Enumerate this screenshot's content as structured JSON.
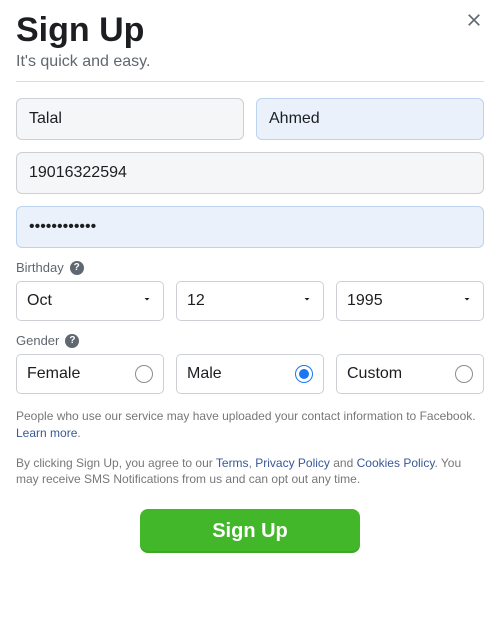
{
  "header": {
    "title": "Sign Up",
    "subtitle": "It's quick and easy."
  },
  "form": {
    "first_name": "Talal",
    "last_name": "Ahmed",
    "contact": "19016322594",
    "password": "••••••••••••"
  },
  "birthday": {
    "label": "Birthday",
    "month": "Oct",
    "day": "12",
    "year": "1995"
  },
  "gender": {
    "label": "Gender",
    "options": {
      "female": "Female",
      "male": "Male",
      "custom": "Custom"
    },
    "selected": "male"
  },
  "disclaimer": {
    "contact_info_pre": "People who use our service may have uploaded your contact information to Facebook. ",
    "learn_more": "Learn more",
    "period": ".",
    "agree_pre": "By clicking Sign Up, you agree to our ",
    "terms": "Terms",
    "sep1": ", ",
    "privacy": "Privacy Policy",
    "sep2": " and ",
    "cookies": "Cookies Policy",
    "agree_post": ". You may receive SMS Notifications from us and can opt out any time."
  },
  "submit_label": "Sign Up"
}
